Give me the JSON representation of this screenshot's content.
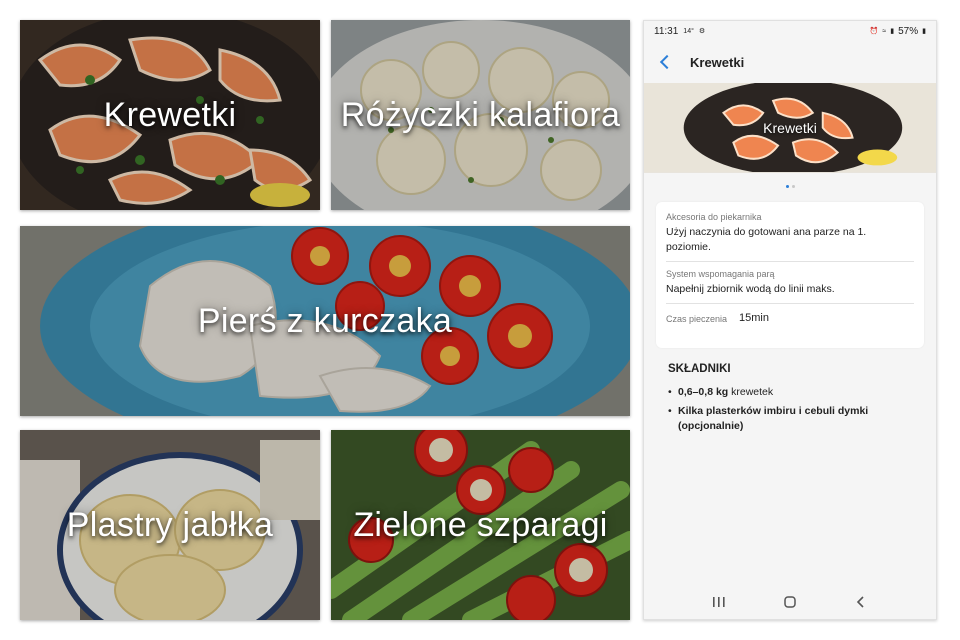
{
  "tiles": [
    {
      "id": "krewetki",
      "label": "Krewetki"
    },
    {
      "id": "kalafior",
      "label": "Różyczki kalafiora"
    },
    {
      "id": "piers",
      "label": "Pierś z kurczaka"
    },
    {
      "id": "jablko",
      "label": "Plastry jabłka"
    },
    {
      "id": "szparagi",
      "label": "Zielone szparagi"
    }
  ],
  "phone": {
    "status": {
      "time": "11:31",
      "temp": "14°",
      "battery": "57%"
    },
    "appbar_title": "Krewetki",
    "hero_label": "Krewetki",
    "info": {
      "accessory_label": "Akcesoria do piekarnika",
      "accessory_value": "Użyj naczynia do gotowani ana parze na 1. poziomie.",
      "steam_label": "System wspomagania parą",
      "steam_value": "Napełnij zbiornik wodą do linii maks.",
      "time_label": "Czas pieczenia",
      "time_value": "15min"
    },
    "ingredients_title": "SKŁADNIKI",
    "ingredients": [
      {
        "bold": "0,6–0,8 kg",
        "rest": " krewetek"
      },
      {
        "bold": "Kilka plasterków imbiru i cebuli dymki (opcjonalnie)",
        "rest": ""
      }
    ]
  },
  "colors": {
    "accent": "#2c7fd8",
    "phone_bg": "#f5f5f5",
    "card_bg": "#ffffff"
  }
}
